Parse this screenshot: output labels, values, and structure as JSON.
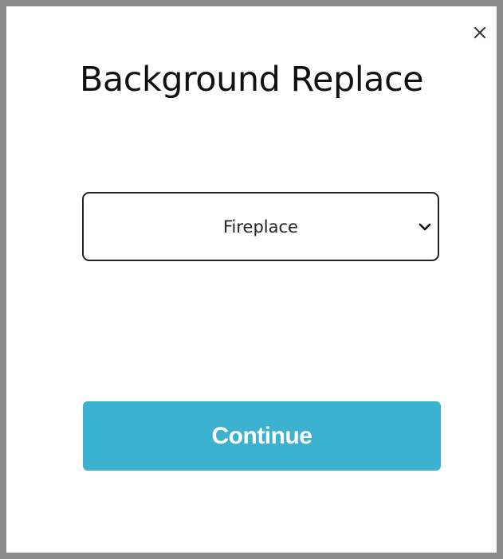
{
  "dialog": {
    "title": "Background Replace",
    "close_icon": "close-icon",
    "select": {
      "selected_value": "Fireplace",
      "icon": "chevron-down-icon"
    },
    "continue_label": "Continue"
  },
  "colors": {
    "backdrop": "#8a8a8a",
    "dialog_background": "#ffffff",
    "accent": "#3cb1d0",
    "text": "#111111"
  }
}
